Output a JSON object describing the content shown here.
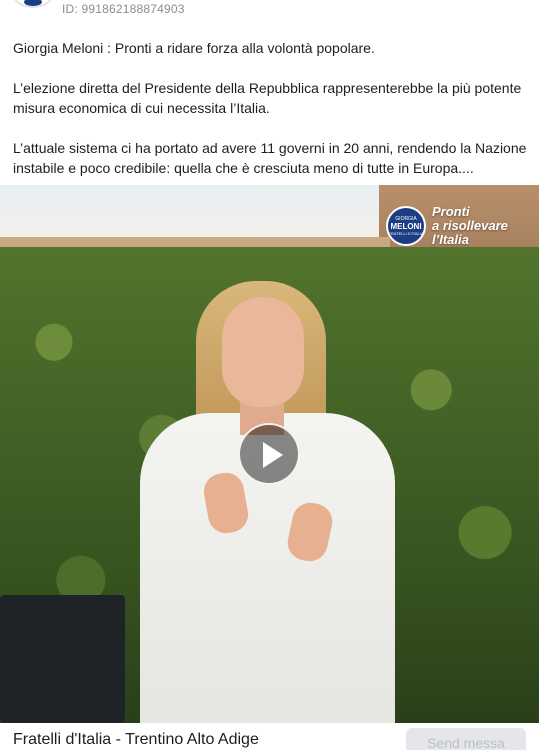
{
  "post": {
    "id_label": "ID: 991862188874903",
    "paragraphs": [
      "Giorgia Meloni : Pronti a ridare forza alla volontà popolare.",
      "L’elezione diretta del Presidente della Repubblica rappresenterebbe la più potente misura economica di cui necessita l’Italia.",
      "L’attuale sistema ci ha portato ad avere 11 governi in 20 anni, rendendo la Nazione instabile e poco credibile: quella che è cresciuta meno di tutte in Europa...."
    ]
  },
  "video": {
    "logo": {
      "top": "GIORGIA",
      "mid": "MELONI",
      "bot": "FRATELLI D'ITALIA"
    },
    "slogan_lines": [
      "Pronti",
      "a risollevare",
      "l’Italia"
    ],
    "play_icon": "play-icon"
  },
  "footer": {
    "page_name": "Fratelli d'Italia - Trentino Alto Adige",
    "send_label": "Send messa"
  }
}
